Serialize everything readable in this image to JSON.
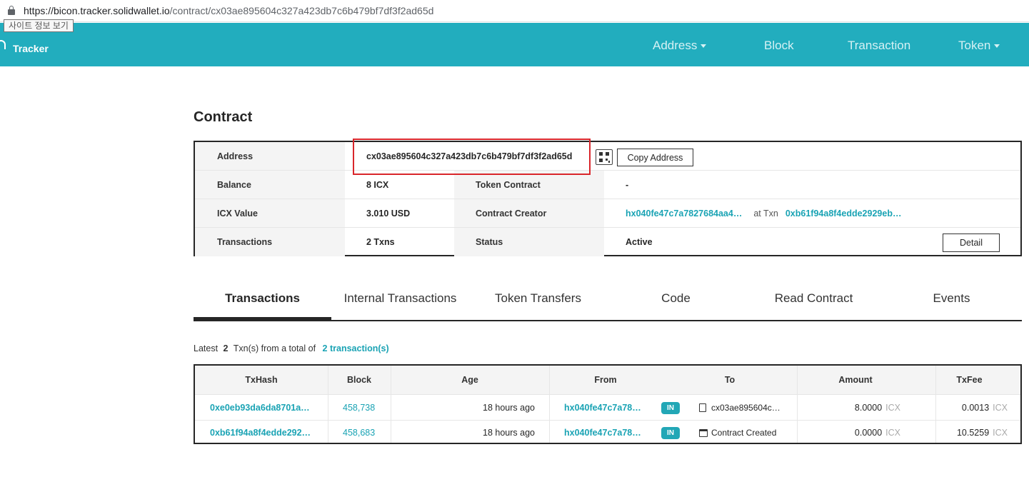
{
  "browser": {
    "url_host": "https://bicon.tracker.solidwallet.io",
    "url_path": "/contract/cx03ae895604c327a423db7c6b479bf7df3f2ad65d",
    "tooltip": "사이트 정보 보기"
  },
  "header": {
    "logo_text": "Tracker",
    "nav": [
      {
        "label": "Address",
        "has_caret": true
      },
      {
        "label": "Block",
        "has_caret": false
      },
      {
        "label": "Transaction",
        "has_caret": false
      },
      {
        "label": "Token",
        "has_caret": true
      }
    ],
    "color": "#22adbe"
  },
  "page": {
    "title": "Contract"
  },
  "summary": {
    "address_label": "Address",
    "address_value": "cx03ae895604c327a423db7c6b479bf7df3f2ad65d",
    "copy_label": "Copy Address",
    "balance_label": "Balance",
    "balance_value": "8 ICX",
    "token_contract_label": "Token Contract",
    "token_contract_value": "-",
    "icx_value_label": "ICX Value",
    "icx_value_value": "3.010 USD",
    "creator_label": "Contract Creator",
    "creator_value": "hx040fe47c7a7827684aa4…",
    "at_txn_label": "at Txn",
    "creator_txn": "0xb61f94a8f4edde2929eb…",
    "transactions_label": "Transactions",
    "transactions_value": "2 Txns",
    "status_label": "Status",
    "status_value": "Active",
    "detail_label": "Detail"
  },
  "tabs": [
    {
      "label": "Transactions",
      "active": true
    },
    {
      "label": "Internal Transactions",
      "active": false
    },
    {
      "label": "Token Transfers",
      "active": false
    },
    {
      "label": "Code",
      "active": false
    },
    {
      "label": "Read Contract",
      "active": false
    },
    {
      "label": "Events",
      "active": false
    }
  ],
  "latest": {
    "prefix": "Latest",
    "count": "2",
    "middle": "Txn(s) from a total of",
    "total_link": "2 transaction(s)"
  },
  "tx_table": {
    "headers": [
      "TxHash",
      "Block",
      "Age",
      "From",
      "To",
      "Amount",
      "TxFee"
    ],
    "rows": [
      {
        "txhash": "0xe0eb93da6da8701a…",
        "block": "458,738",
        "age": "18 hours ago",
        "from": "hx040fe47c7a78…",
        "direction": "IN",
        "to_icon": "document-icon",
        "to": "cx03ae895604c…",
        "amount": "8.0000",
        "amount_unit": "ICX",
        "fee": "0.0013",
        "fee_unit": "ICX"
      },
      {
        "txhash": "0xb61f94a8f4edde292…",
        "block": "458,683",
        "age": "18 hours ago",
        "from": "hx040fe47c7a78…",
        "direction": "IN",
        "to_icon": "calendar-icon",
        "to": "Contract Created",
        "amount": "0.0000",
        "amount_unit": "ICX",
        "fee": "10.5259",
        "fee_unit": "ICX"
      }
    ]
  }
}
